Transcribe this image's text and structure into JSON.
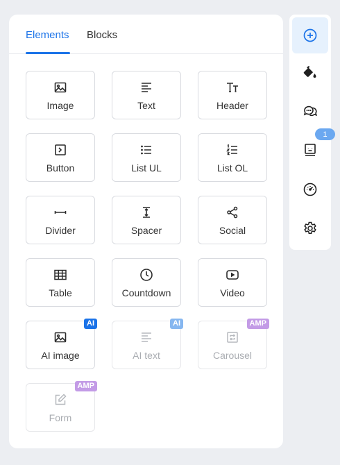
{
  "tabs": {
    "elements": "Elements",
    "blocks": "Blocks"
  },
  "items": [
    {
      "label": "Image",
      "icon": "image-icon"
    },
    {
      "label": "Text",
      "icon": "text-icon"
    },
    {
      "label": "Header",
      "icon": "header-icon"
    },
    {
      "label": "Button",
      "icon": "button-icon"
    },
    {
      "label": "List UL",
      "icon": "list-ul-icon"
    },
    {
      "label": "List OL",
      "icon": "list-ol-icon"
    },
    {
      "label": "Divider",
      "icon": "divider-icon"
    },
    {
      "label": "Spacer",
      "icon": "spacer-icon"
    },
    {
      "label": "Social",
      "icon": "share-icon"
    },
    {
      "label": "Table",
      "icon": "table-icon"
    },
    {
      "label": "Countdown",
      "icon": "clock-icon"
    },
    {
      "label": "Video",
      "icon": "video-icon"
    },
    {
      "label": "AI image",
      "icon": "image-icon",
      "badge": "AI",
      "badge_color": "#1b73e8"
    },
    {
      "label": "AI text",
      "icon": "text-icon",
      "badge": "AI",
      "badge_color": "#86b7f0",
      "disabled": true
    },
    {
      "label": "Carousel",
      "icon": "carousel-icon",
      "badge": "AMP",
      "badge_color": "#c39be6",
      "disabled": true
    },
    {
      "label": "Form",
      "icon": "edit-icon",
      "badge": "AMP",
      "badge_color": "#c39be6",
      "disabled": true
    }
  ],
  "rail": {
    "buttons": [
      {
        "icon": "add-circle-icon",
        "active": true
      },
      {
        "icon": "paint-bucket-icon"
      },
      {
        "icon": "chat-bubbles-icon"
      },
      {
        "icon": "template-icon"
      },
      {
        "icon": "speedometer-icon"
      },
      {
        "icon": "gear-icon"
      }
    ],
    "template_count": "1"
  },
  "colors": {
    "accent": "#1b73e8",
    "background": "#eceef2"
  }
}
